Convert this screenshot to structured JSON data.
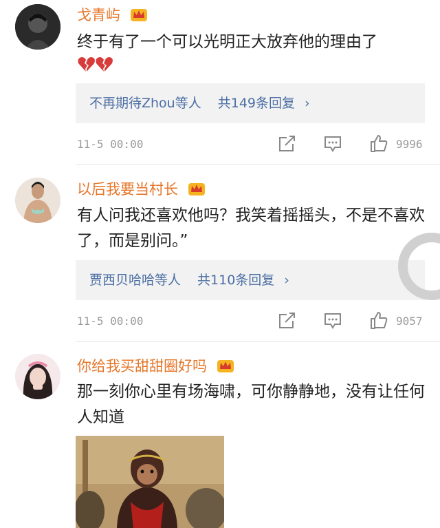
{
  "comments": [
    {
      "username": "戈青屿",
      "text": "终于有了一个可以光明正大放弃他的理由了",
      "reply_users": "不再期待Zhou等人",
      "reply_count": "共149条回复",
      "time": "11-5 00:00",
      "likes": "9996"
    },
    {
      "username": "以后我要当村长",
      "text": "有人问我还喜欢他吗？我笑着摇摇头，不是不喜欢了，而是别问。”",
      "reply_users": "贾西贝哈哈等人",
      "reply_count": "共110条回复",
      "time": "11-5 00:00",
      "likes": "9057"
    },
    {
      "username": "你给我买甜甜圈好吗",
      "text": "那一刻你心里有场海啸，可你静静地，没有让任何人知道"
    }
  ],
  "icons": {
    "crown": "vip-crown-icon",
    "broken_heart": "broken-heart-icon",
    "share": "share-icon",
    "comment": "comment-icon",
    "like": "thumbs-up-icon",
    "chevron": "chevron-right-icon"
  },
  "colors": {
    "username": "#e5762a",
    "reply_link": "#4b6ea3",
    "meta": "#999999",
    "reply_bg": "#f2f2f2"
  },
  "chevron_glyph": "›"
}
